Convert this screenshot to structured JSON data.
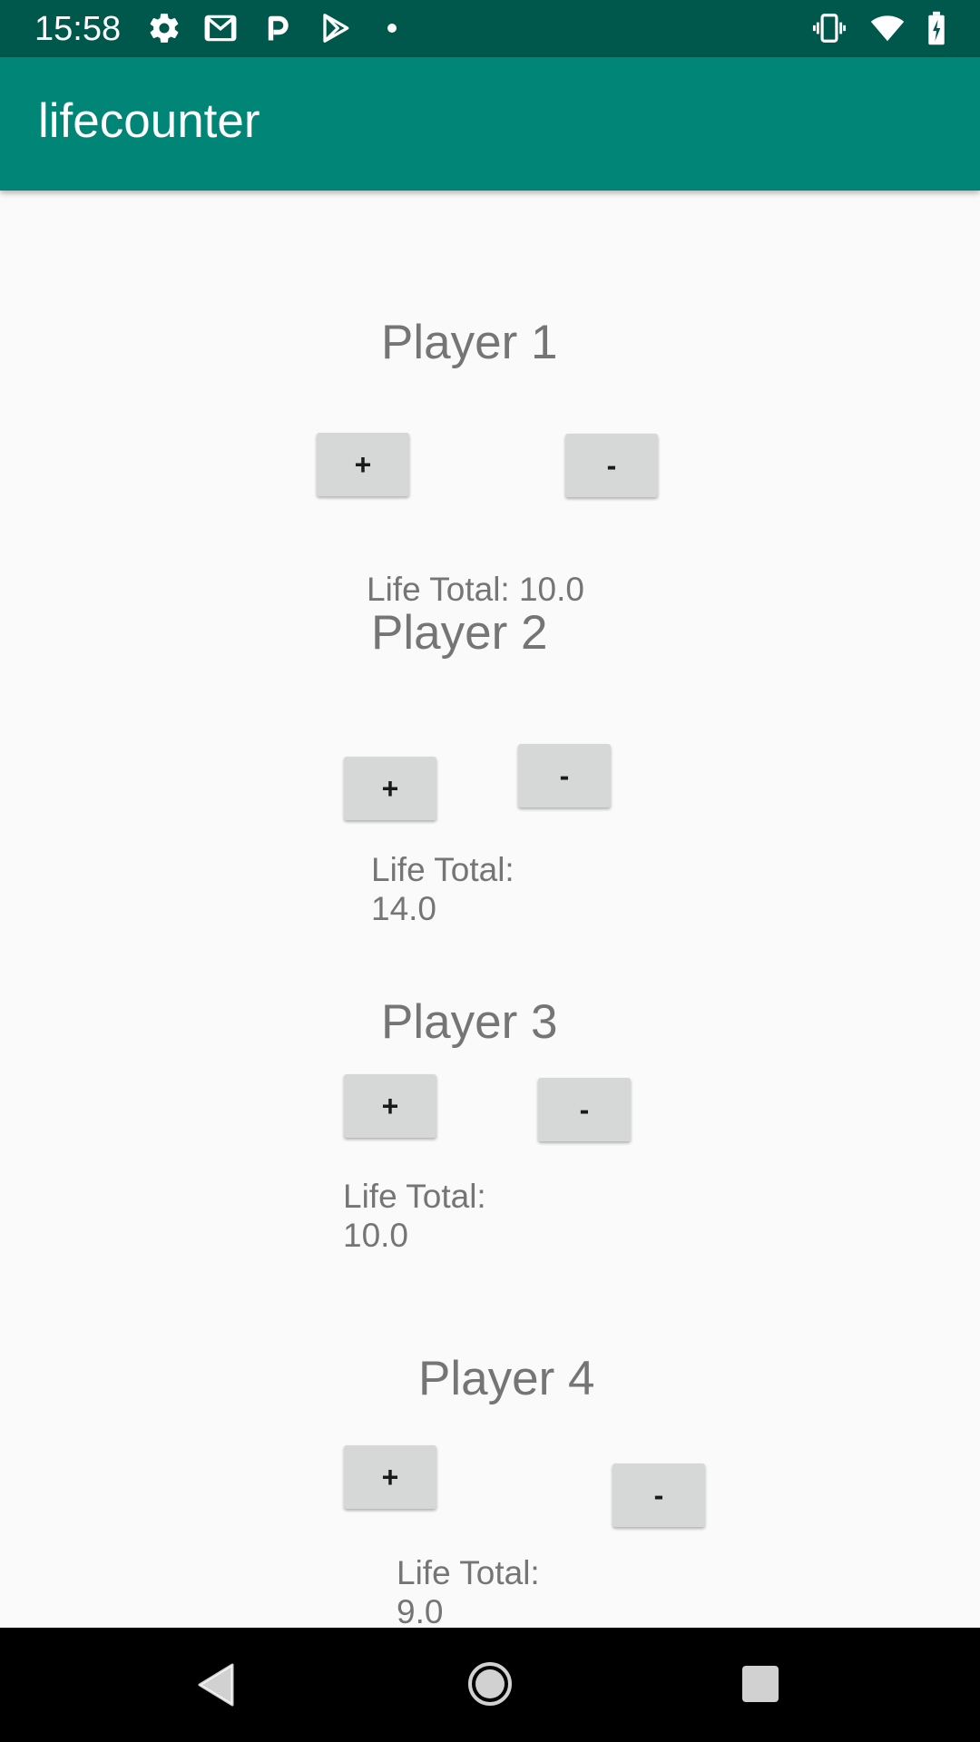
{
  "status_bar": {
    "time": "15:58",
    "left_icons": [
      "gear-icon",
      "gmail-icon",
      "p-app-icon",
      "play-store-icon",
      "dot-icon"
    ],
    "right_icons": [
      "vibrate-icon",
      "wifi-icon",
      "battery-charging-icon"
    ]
  },
  "app_bar": {
    "title": "lifecounter",
    "color": "#008577",
    "status_color": "#00574b"
  },
  "players": [
    {
      "name": "Player 1",
      "plus_label": "+",
      "minus_label": "-",
      "life_label": "Life Total: 10.0"
    },
    {
      "name": "Player 2",
      "plus_label": "+",
      "minus_label": "-",
      "life_label": "Life Total:",
      "life_value": "14.0"
    },
    {
      "name": "Player 3",
      "plus_label": "+",
      "minus_label": "-",
      "life_label": "Life Total:",
      "life_value": "10.0"
    },
    {
      "name": "Player 4",
      "plus_label": "+",
      "minus_label": "-",
      "life_label": "Life Total:",
      "life_value": "9.0"
    }
  ],
  "nav_bar": {
    "buttons": [
      "back-icon",
      "home-icon",
      "recents-icon"
    ]
  }
}
